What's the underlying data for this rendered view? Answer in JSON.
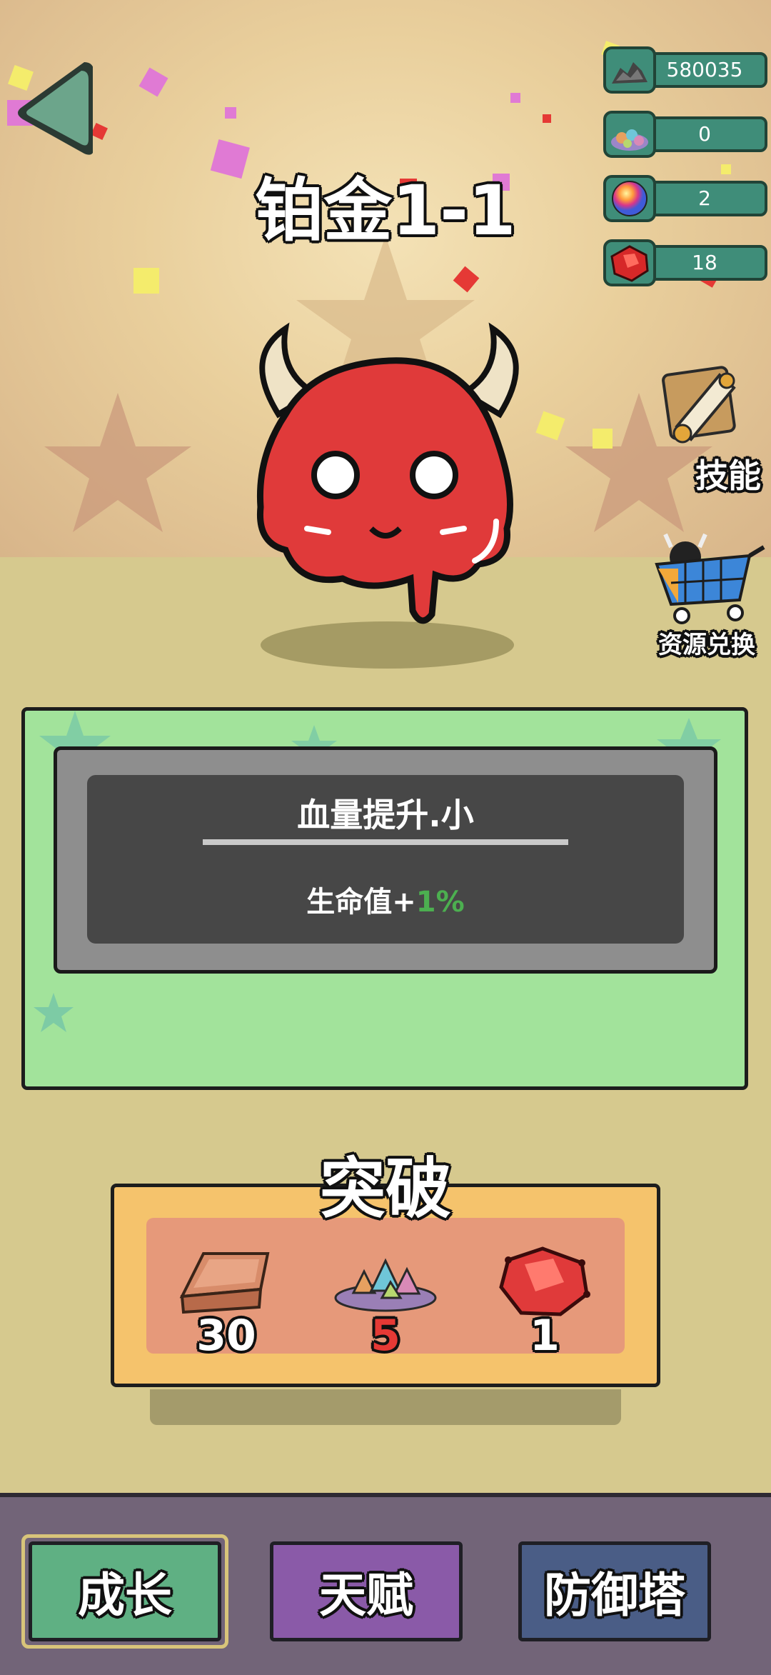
{
  "header": {
    "stage_title": "铂金1-1"
  },
  "resources": [
    {
      "icon": "ore-pile-icon",
      "value": "580035"
    },
    {
      "icon": "crystal-pile-icon",
      "value": "0"
    },
    {
      "icon": "rainbow-orb-icon",
      "value": "2"
    },
    {
      "icon": "red-gem-icon",
      "value": "18"
    }
  ],
  "side_buttons": {
    "skills_label": "技能",
    "exchange_label": "资源兑换"
  },
  "skill_card": {
    "name": "血量提升.小",
    "effect_prefix": "生命值+",
    "effect_value": "1%"
  },
  "breakthrough": {
    "title": "突破",
    "costs": [
      {
        "icon": "copper-ingot-icon",
        "amount": "30",
        "color": "#ffffff"
      },
      {
        "icon": "crystal-pile-icon",
        "amount": "5",
        "color": "#e53935"
      },
      {
        "icon": "red-gem-icon",
        "amount": "1",
        "color": "#ffffff"
      }
    ]
  },
  "tabs": [
    {
      "label": "成长",
      "color": "#5fb083",
      "selected": true
    },
    {
      "label": "天赋",
      "color": "#8a5aa8",
      "selected": false
    },
    {
      "label": "防御塔",
      "color": "#4a5d86",
      "selected": false
    }
  ],
  "colors": {
    "accent_green": "#4caf50",
    "panel_green": "#a2e39b"
  }
}
